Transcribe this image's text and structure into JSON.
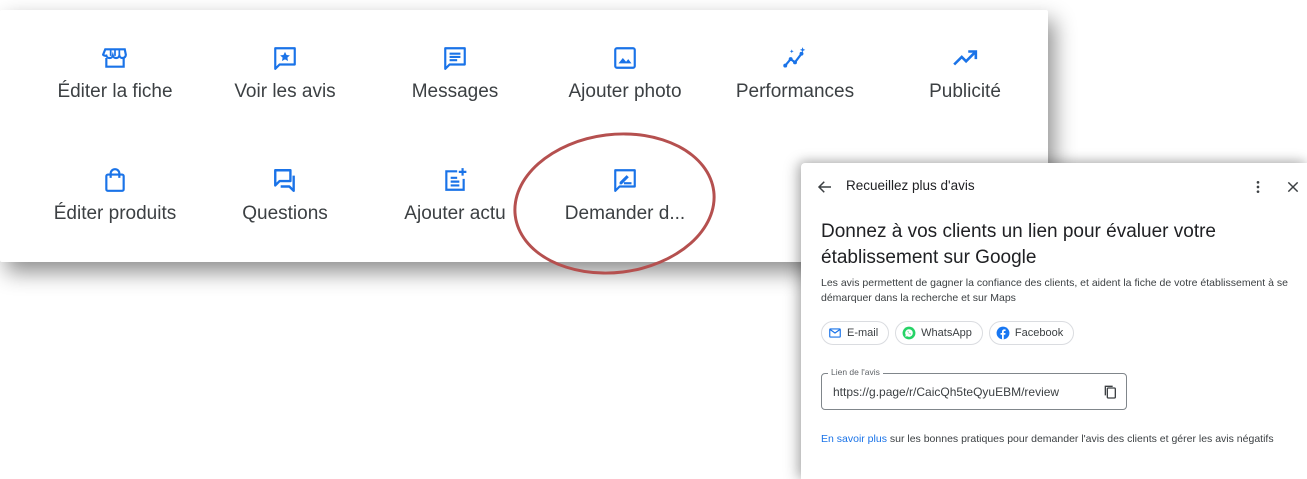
{
  "actions": [
    {
      "label": "Éditer la fiche",
      "icon": "storefront-icon"
    },
    {
      "label": "Voir les avis",
      "icon": "star-review-icon"
    },
    {
      "label": "Messages",
      "icon": "message-icon"
    },
    {
      "label": "Ajouter photo",
      "icon": "add-photo-icon"
    },
    {
      "label": "Performances",
      "icon": "insights-icon"
    },
    {
      "label": "Publicité",
      "icon": "trending-up-icon"
    },
    {
      "label": "Éditer produits",
      "icon": "shopping-bag-icon"
    },
    {
      "label": "Questions",
      "icon": "forum-icon"
    },
    {
      "label": "Ajouter actu",
      "icon": "post-add-icon"
    },
    {
      "label": "Demander d...",
      "icon": "rate-review-icon"
    }
  ],
  "dialog": {
    "title": "Recueillez plus d'avis",
    "heading": "Donnez à vos clients un lien pour évaluer votre établissement sur Google",
    "description": "Les avis permettent de gagner la confiance des clients, et aident la fiche de votre établissement à se démarquer dans la recherche et sur Maps",
    "share": [
      {
        "label": "E-mail",
        "icon": "mail-icon"
      },
      {
        "label": "WhatsApp",
        "icon": "whatsapp-icon"
      },
      {
        "label": "Facebook",
        "icon": "facebook-icon"
      }
    ],
    "link_label": "Lien de l'avis",
    "link_value": "https://g.page/r/CaicQh5teQyuEBM/review",
    "footer_link": "En savoir plus",
    "footer_text": " sur les bonnes pratiques pour demander l'avis des clients et gérer les avis négatifs"
  },
  "colors": {
    "accent": "#1a73e8",
    "highlight": "#b5504f",
    "whatsapp": "#25d366",
    "facebook": "#1877f2"
  }
}
